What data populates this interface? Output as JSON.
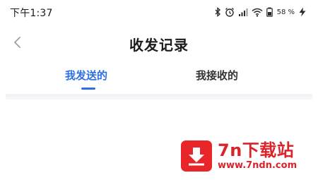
{
  "status_bar": {
    "time": "下午1:37",
    "battery": "58 %",
    "icons": [
      "bluetooth-icon",
      "alarm-icon",
      "signal-icon",
      "wifi-icon",
      "battery-icon",
      "charging-icon"
    ]
  },
  "header": {
    "title": "收发记录",
    "back_icon": "chevron-left-icon"
  },
  "tabs": [
    {
      "label": "我发送的",
      "active": true
    },
    {
      "label": "我接收的",
      "active": false
    }
  ],
  "colors": {
    "accent": "#2f6fe4",
    "watermark": "#d9242a"
  },
  "watermark": {
    "title": "7n下载站",
    "url": "www.7ndn.com"
  }
}
